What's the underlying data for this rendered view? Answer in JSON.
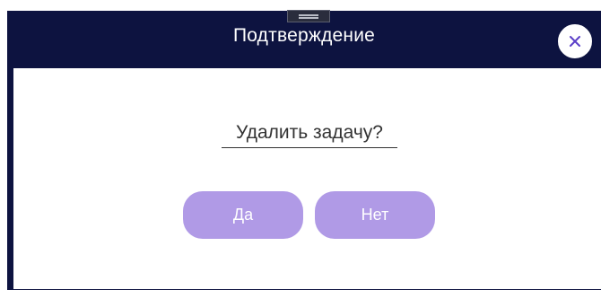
{
  "dialog": {
    "title": "Подтверждение",
    "question": "Удалить задачу?",
    "close_icon": "close-icon"
  },
  "buttons": {
    "yes_label": "Да",
    "no_label": "Нет"
  },
  "colors": {
    "header_bg": "#0d1340",
    "button_bg": "#b09ae6",
    "close_icon": "#5b3fc8"
  }
}
